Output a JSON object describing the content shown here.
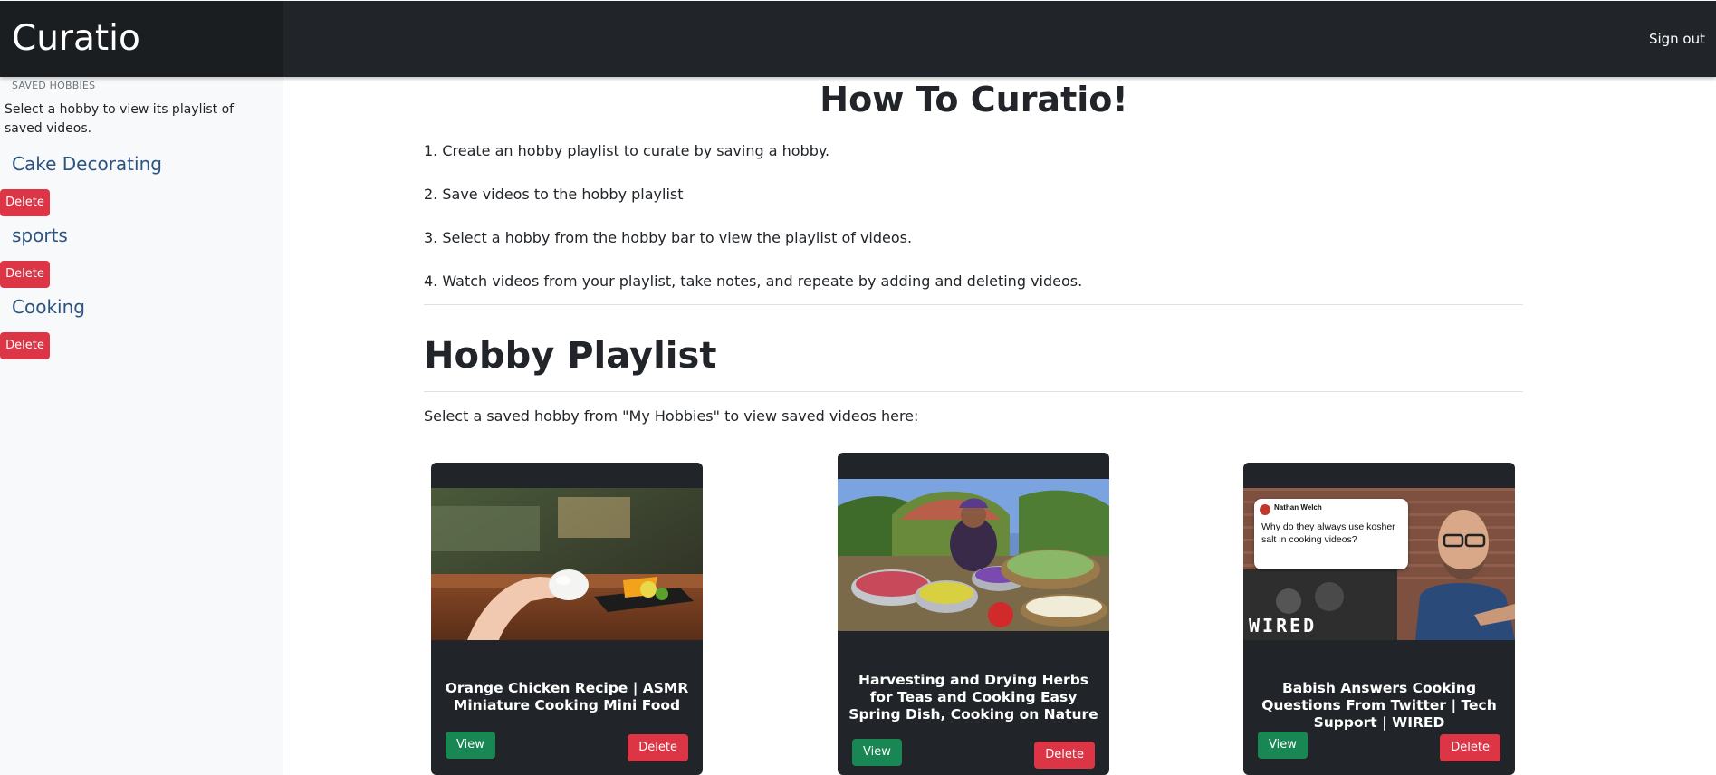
{
  "navbar": {
    "brand": "Curatio",
    "signout_label": "Sign out"
  },
  "sidebar": {
    "heading": "SAVED HOBBIES",
    "description": "Select a hobby to view its playlist of saved videos.",
    "hobbies": [
      {
        "name": "Cake Decorating",
        "delete_label": "Delete"
      },
      {
        "name": "sports",
        "delete_label": "Delete"
      },
      {
        "name": "Cooking",
        "delete_label": "Delete"
      }
    ]
  },
  "main": {
    "how_title": "How To Curatio!",
    "steps": [
      "1. Create an hobby playlist to curate by saving a hobby.",
      "2. Save videos to the hobby playlist",
      "3. Select a hobby from the hobby bar to view the playlist of videos.",
      "4. Watch videos from your playlist, take notes, and repeate by adding and deleting videos."
    ],
    "playlist_title": "Hobby Playlist",
    "playlist_desc": "Select a saved hobby from \"My Hobbies\" to view saved videos here:",
    "videos": [
      {
        "title": "Orange Chicken Recipe | ASMR Miniature Cooking Mini Food",
        "view_label": "View",
        "delete_label": "Delete"
      },
      {
        "title": "Harvesting and Drying Herbs for Teas and Cooking Easy Spring Dish, Cooking on Nature",
        "view_label": "View",
        "delete_label": "Delete"
      },
      {
        "title": "Babish Answers Cooking Questions From Twitter | Tech Support | WIRED",
        "view_label": "View",
        "delete_label": "Delete"
      }
    ],
    "thumb3": {
      "tweet_user": "Nathan Welch",
      "tweet_text": "Why do they always use kosher salt in cooking videos?",
      "logo": "WIRED"
    }
  },
  "colors": {
    "navbar": "#212529",
    "danger": "#dc3545",
    "success": "#198754",
    "link": "#2c5282"
  }
}
